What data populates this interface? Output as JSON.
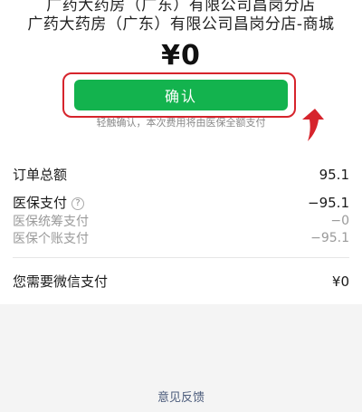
{
  "merchant": {
    "top_line": "广药大药房（广东）有限公司昌岗分店",
    "name": "广药大药房（广东）有限公司昌岗分店-商城"
  },
  "amount": "¥0",
  "confirm": {
    "label": "确认",
    "hint": "轻触确认，本次费用将由医保全额支付"
  },
  "colors": {
    "button": "#13b34e",
    "highlight": "#d6242c"
  },
  "details": {
    "order_total_label": "订单总额",
    "order_total_value": "95.1",
    "insurance_label": "医保支付",
    "insurance_value": "−95.1",
    "pooled_label": "医保统筹支付",
    "pooled_value": "−0",
    "personal_label": "医保个账支付",
    "personal_value": "−95.1",
    "wechat_label": "您需要微信支付",
    "wechat_value": "¥0"
  },
  "footer": {
    "feedback_label": "意见反馈"
  }
}
